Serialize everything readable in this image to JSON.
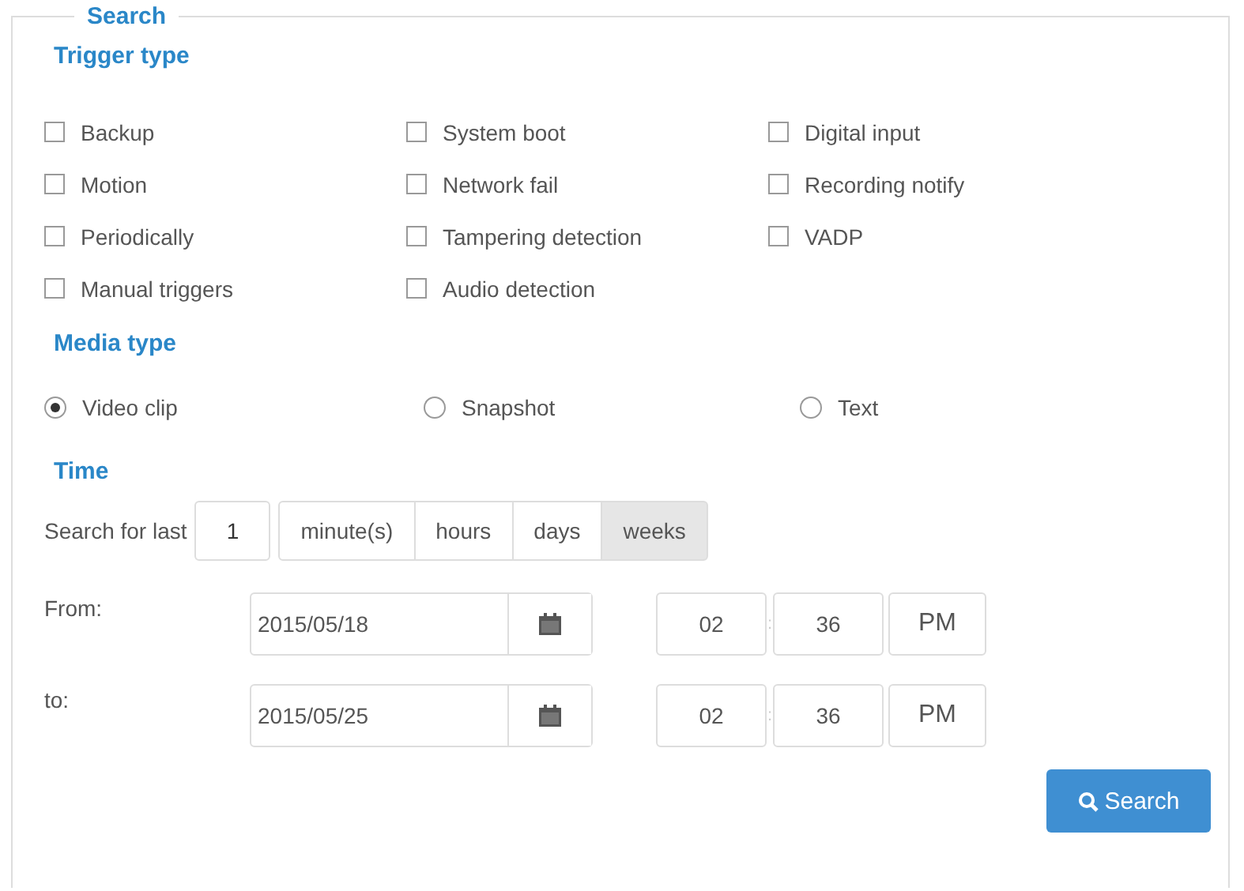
{
  "legend": "Search",
  "trigger": {
    "heading": "Trigger type",
    "columns": [
      [
        {
          "label": "Backup",
          "checked": false
        },
        {
          "label": "Motion",
          "checked": false
        },
        {
          "label": "Periodically",
          "checked": false
        },
        {
          "label": "Manual triggers",
          "checked": false
        }
      ],
      [
        {
          "label": "System boot",
          "checked": false
        },
        {
          "label": "Network fail",
          "checked": false
        },
        {
          "label": "Tampering detection",
          "checked": false
        },
        {
          "label": "Audio detection",
          "checked": false
        }
      ],
      [
        {
          "label": "Digital input",
          "checked": false
        },
        {
          "label": "Recording notify",
          "checked": false
        },
        {
          "label": "VADP",
          "checked": false
        }
      ]
    ]
  },
  "media": {
    "heading": "Media type",
    "options": [
      {
        "label": "Video clip",
        "selected": true
      },
      {
        "label": "Snapshot",
        "selected": false
      },
      {
        "label": "Text",
        "selected": false
      }
    ]
  },
  "time": {
    "heading": "Time",
    "search_label": "Search for last",
    "count": "1",
    "units": [
      {
        "label": "minute(s)",
        "selected": false
      },
      {
        "label": "hours",
        "selected": false
      },
      {
        "label": "days",
        "selected": false
      },
      {
        "label": "weeks",
        "selected": true
      }
    ],
    "ranges": [
      {
        "label": "From:",
        "date": "2015/05/18",
        "hour": "02",
        "separator": ":",
        "minute": "36",
        "ampm": "PM"
      },
      {
        "label": "to:",
        "date": "2015/05/25",
        "hour": "02",
        "separator": ":",
        "minute": "36",
        "ampm": "PM"
      }
    ]
  },
  "search_button": "Search"
}
